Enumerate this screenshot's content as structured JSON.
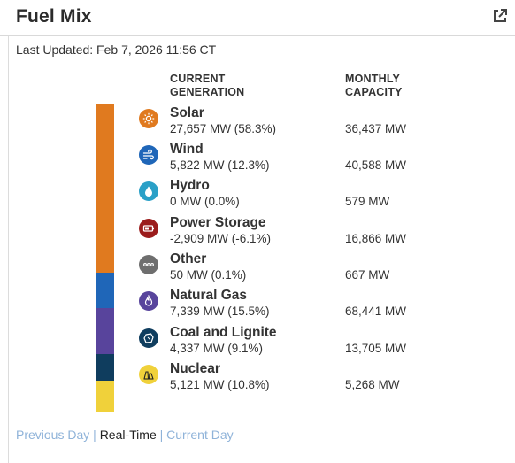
{
  "title": "Fuel Mix",
  "external_link_icon": "external-link-icon",
  "last_updated": "Last Updated: Feb 7, 2026 11:56 CT",
  "columns": {
    "current": "CURRENT GENERATION",
    "capacity": "MONTHLY CAPACITY"
  },
  "fuels": [
    {
      "name": "Solar",
      "generation": "27,657 MW (58.3%)",
      "capacity": "36,437 MW",
      "color": "#e07a1f",
      "icon": "sun-icon",
      "share": 58.3
    },
    {
      "name": "Wind",
      "generation": "5,822 MW (12.3%)",
      "capacity": "40,588 MW",
      "color": "#1f66b8",
      "icon": "wind-icon",
      "share": 12.3
    },
    {
      "name": "Hydro",
      "generation": "0 MW (0.0%)",
      "capacity": "579 MW",
      "color": "#2aa0c7",
      "icon": "water-drop-icon",
      "share": 0.0
    },
    {
      "name": "Power Storage",
      "generation": "-2,909 MW (-6.1%)",
      "capacity": "16,866 MW",
      "color": "#9b1c1c",
      "icon": "battery-icon",
      "share": -6.1
    },
    {
      "name": "Other",
      "generation": "50 MW (0.1%)",
      "capacity": "667 MW",
      "color": "#6e6e6e",
      "icon": "dots-icon",
      "share": 0.1
    },
    {
      "name": "Natural Gas",
      "generation": "7,339 MW (15.5%)",
      "capacity": "68,441 MW",
      "color": "#58449c",
      "icon": "flame-icon",
      "share": 15.5
    },
    {
      "name": "Coal and Lignite",
      "generation": "4,337 MW (9.1%)",
      "capacity": "13,705 MW",
      "color": "#0f3d5e",
      "icon": "coal-icon",
      "share": 9.1
    },
    {
      "name": "Nuclear",
      "generation": "5,121 MW (10.8%)",
      "capacity": "5,268 MW",
      "color": "#f0d13a",
      "icon": "nuclear-icon",
      "share": 10.8
    }
  ],
  "footer": {
    "previous": "Previous Day",
    "realtime": "Real-Time",
    "current": "Current Day",
    "separator": "|"
  }
}
